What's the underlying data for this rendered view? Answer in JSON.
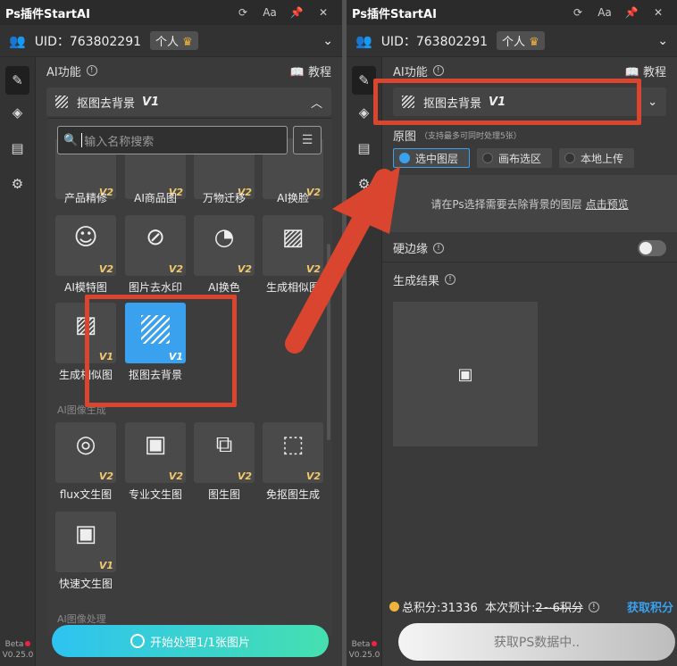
{
  "app_title": "Ps插件StartAI",
  "titlebar_icons": [
    "refresh-icon",
    "font-size-icon",
    "pin-icon",
    "close-icon"
  ],
  "titlebar_font_label": "Aa",
  "uid_text": "UID：763802291",
  "plan_badge": "个人",
  "ai_feature_label": "AI功能",
  "tutorial_label": "教程",
  "selected_feature": "抠图去背景",
  "selected_version": "V1",
  "search_placeholder": "输入名称搜索",
  "tiles": [
    {
      "label": "产品精修",
      "version": "V2"
    },
    {
      "label": "AI商品图",
      "version": "V2"
    },
    {
      "label": "万物迁移",
      "version": "V2"
    },
    {
      "label": "AI换脸",
      "version": "V2"
    },
    {
      "label": "AI模特图",
      "version": "V2"
    },
    {
      "label": "图片去水印",
      "version": "V2"
    },
    {
      "label": "AI换色",
      "version": "V2"
    },
    {
      "label": "生成相似图",
      "version": "V2"
    },
    {
      "label": "生成相似图",
      "version": "V1"
    },
    {
      "label": "抠图去背景",
      "version": "V1"
    },
    {
      "label": "flux文生图",
      "version": "V2"
    },
    {
      "label": "专业文生图",
      "version": "V2"
    },
    {
      "label": "图生图",
      "version": "V2"
    },
    {
      "label": "免抠图生成",
      "version": "V2"
    },
    {
      "label": "快速文生图",
      "version": "V1"
    }
  ],
  "category_gen": "AI图像生成",
  "category_proc": "AI图像处理",
  "start_button": "开始处理1/1张图片",
  "beta_label": "Beta",
  "version_label": "V0.25.0",
  "orig_label": "原图",
  "orig_note": "（支持最多可同时处理5张）",
  "radios": [
    "选中图层",
    "画布选区",
    "本地上传"
  ],
  "hint_text": "请在Ps选择需要去除背景的图层",
  "hint_link": "点击预览",
  "hard_edge_label": "硬边缘",
  "result_label": "生成结果",
  "points_text": "总积分:31336",
  "estimate_label": "本次预计:",
  "estimate_value": "2~6积分",
  "earn_label": "获取积分",
  "fetch_button": "获取PS数据中..",
  "accent_color": "#3aa1ee",
  "highlight_color": "#d9452e"
}
